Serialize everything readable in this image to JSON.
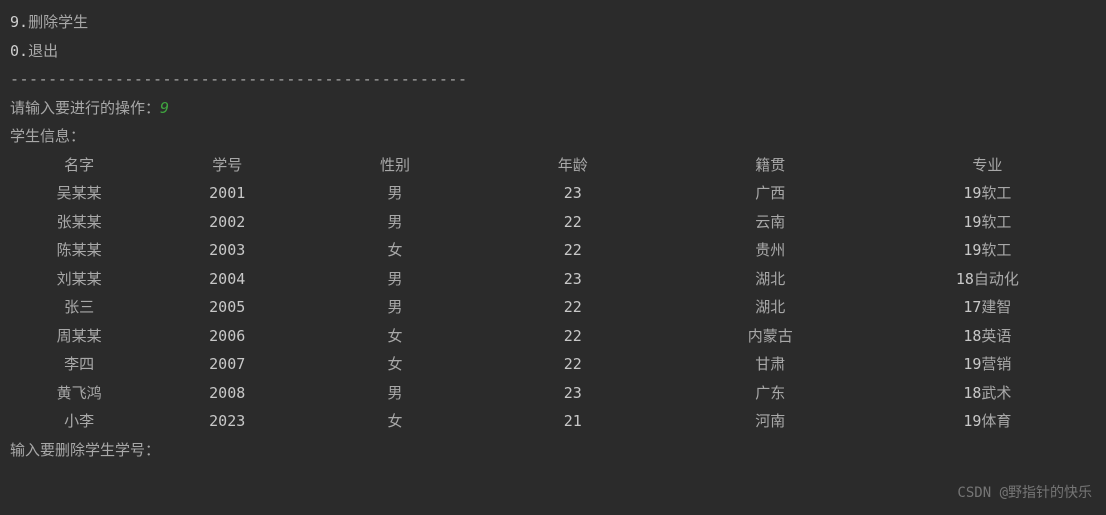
{
  "menu": {
    "item9_num": "9.",
    "item9_label": "删除学生",
    "item0_num": "0.",
    "item0_label": "退出"
  },
  "divider": "------------------------------------------------",
  "prompt_input_label": "请输入要进行的操作：",
  "prompt_input_value": "9",
  "info_header": "学生信息：",
  "columns": {
    "c1": "名字",
    "c2": "学号",
    "c3": "性别",
    "c4": "年龄",
    "c5": "籍贯",
    "c6": "专业"
  },
  "rows": [
    {
      "name": "吴某某",
      "id": "2001",
      "gender": "男",
      "age": "23",
      "origin": "广西",
      "major": "19软工"
    },
    {
      "name": "张某某",
      "id": "2002",
      "gender": "男",
      "age": "22",
      "origin": "云南",
      "major": "19软工"
    },
    {
      "name": "陈某某",
      "id": "2003",
      "gender": "女",
      "age": "22",
      "origin": "贵州",
      "major": "19软工"
    },
    {
      "name": "刘某某",
      "id": "2004",
      "gender": "男",
      "age": "23",
      "origin": "湖北",
      "major": "18自动化"
    },
    {
      "name": "张三",
      "id": "2005",
      "gender": "男",
      "age": "22",
      "origin": "湖北",
      "major": "17建智"
    },
    {
      "name": "周某某",
      "id": "2006",
      "gender": "女",
      "age": "22",
      "origin": "内蒙古",
      "major": "18英语"
    },
    {
      "name": "李四",
      "id": "2007",
      "gender": "女",
      "age": "22",
      "origin": "甘肃",
      "major": "19营销"
    },
    {
      "name": "黄飞鸿",
      "id": "2008",
      "gender": "男",
      "age": "23",
      "origin": "广东",
      "major": "18武术"
    },
    {
      "name": "小李",
      "id": "2023",
      "gender": "女",
      "age": "21",
      "origin": "河南",
      "major": "19体育"
    }
  ],
  "delete_prompt": "输入要删除学生学号：",
  "watermark": "CSDN @野指针的快乐"
}
